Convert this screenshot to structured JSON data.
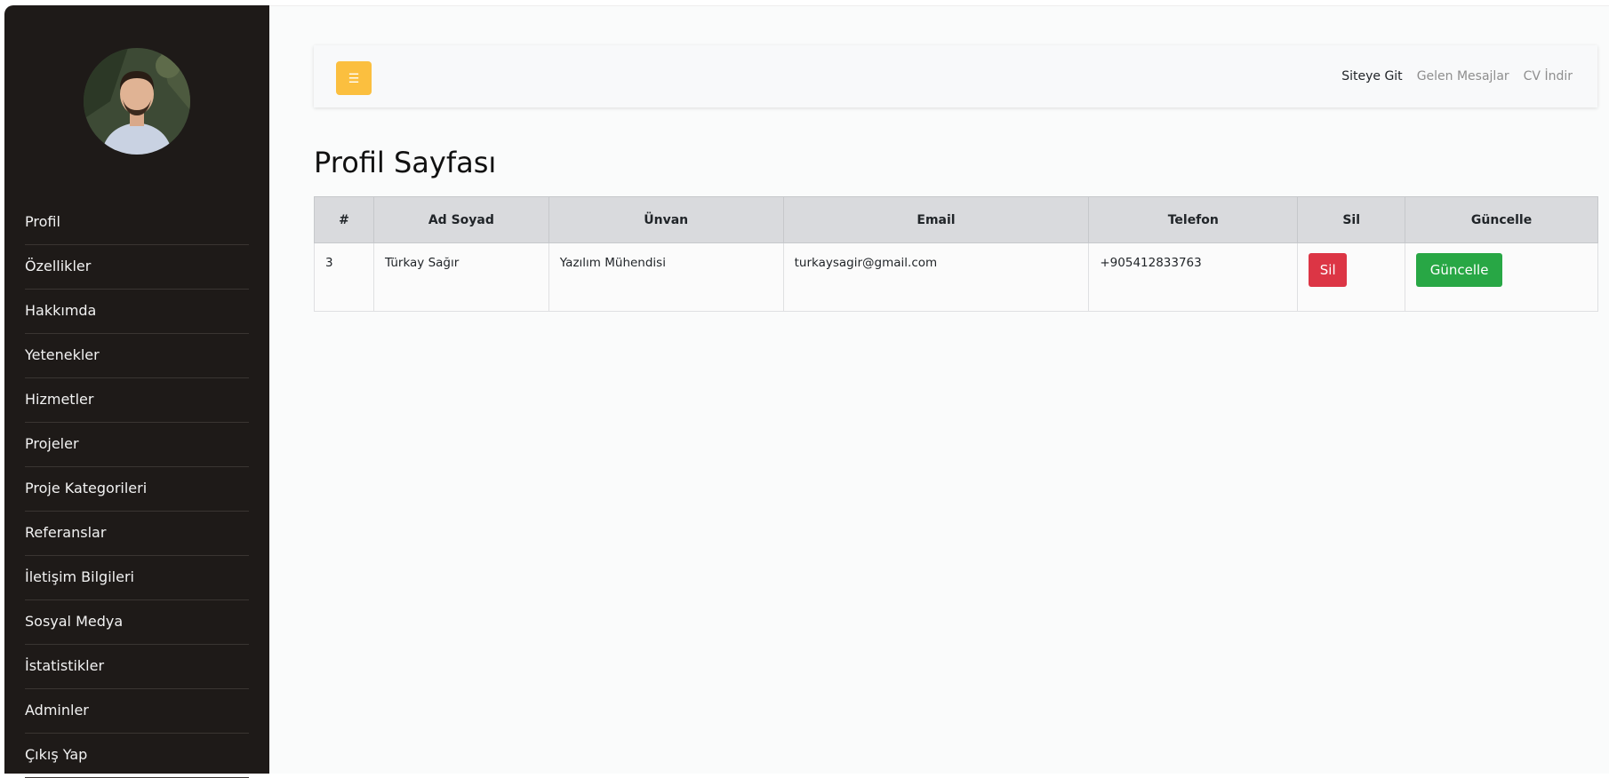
{
  "sidebar": {
    "avatar_alt": "profile photo",
    "items": [
      {
        "label": "Profil"
      },
      {
        "label": "Özellikler"
      },
      {
        "label": "Hakkımda"
      },
      {
        "label": "Yetenekler"
      },
      {
        "label": "Hizmetler"
      },
      {
        "label": "Projeler"
      },
      {
        "label": "Proje Kategorileri"
      },
      {
        "label": "Referanslar"
      },
      {
        "label": "İletişim Bilgileri"
      },
      {
        "label": "Sosyal Medya"
      },
      {
        "label": "İstatistikler"
      },
      {
        "label": "Adminler"
      },
      {
        "label": "Çıkış Yap"
      }
    ]
  },
  "topbar": {
    "toggle_icon": "menu-icon",
    "links": [
      "Siteye Git",
      "Gelen Mesajlar",
      "CV İndir"
    ]
  },
  "page": {
    "title": "Profil Sayfası"
  },
  "table": {
    "headers": [
      "#",
      "Ad Soyad",
      "Ünvan",
      "Email",
      "Telefon",
      "Sil",
      "Güncelle"
    ],
    "rows": [
      {
        "id": "3",
        "name": "Türkay Sağır",
        "title": "Yazılım Mühendisi",
        "email": "turkaysagir@gmail.com",
        "phone": "+905412833763",
        "delete_label": "Sil",
        "update_label": "Güncelle"
      }
    ]
  },
  "colors": {
    "sidebar_bg": "#1e1a18",
    "toggle_bg": "#fbbf3f",
    "danger": "#dc3545",
    "success": "#28a745"
  }
}
